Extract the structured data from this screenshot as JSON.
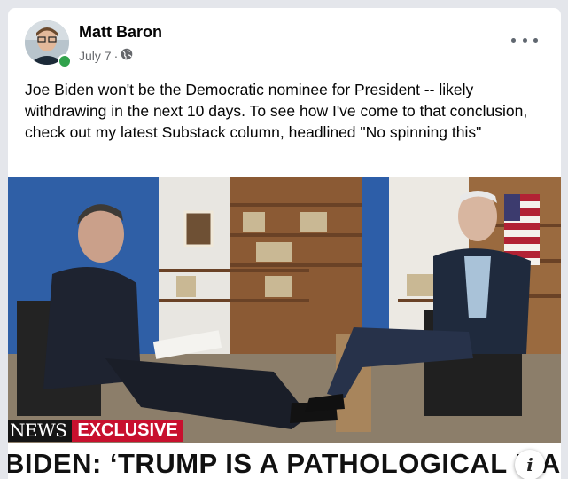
{
  "post": {
    "author": "Matt Baron",
    "date": "July 7",
    "separator": "·",
    "audience_icon": "globe-icon",
    "text": "Joe Biden won't be the Democratic nominee for President -- likely withdrawing in the next 10 days. To see how I've come to that conclusion, check out my latest Substack column, headlined \"No spinning this\""
  },
  "media": {
    "network": "NEWS",
    "tag": "EXCLUSIVE",
    "headline": "BIDEN: ‘TRUMP IS A PATHOLOGICAL LIAR’",
    "info_label": "i"
  },
  "colors": {
    "online": "#31a24c",
    "exclusive": "#c8102e"
  }
}
